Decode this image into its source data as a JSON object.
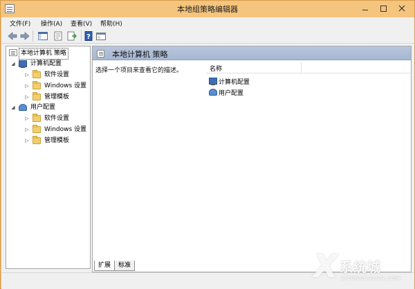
{
  "window": {
    "title": "本地组策略编辑器"
  },
  "menu": {
    "file": "文件(F)",
    "action": "操作(A)",
    "view": "查看(V)",
    "help": "帮助(H)"
  },
  "toolbar": {
    "icons": [
      "back-arrow-icon",
      "forward-arrow-icon",
      "show-tree-icon",
      "properties-icon",
      "export-list-icon",
      "help-icon",
      "console-icon"
    ]
  },
  "tree": {
    "root": "本地计算机 策略",
    "computer_config": {
      "label": "计算机配置",
      "children": [
        "软件设置",
        "Windows 设置",
        "管理模板"
      ]
    },
    "user_config": {
      "label": "用户配置",
      "children": [
        "软件设置",
        "Windows 设置",
        "管理模板"
      ]
    }
  },
  "right_pane": {
    "header_title": "本地计算机 策略",
    "description": "选择一个项目来查看它的描述。",
    "column_name": "名称",
    "items": [
      "计算机配置",
      "用户配置"
    ]
  },
  "tabs": {
    "expanded": "扩展",
    "standard": "标准"
  },
  "watermark": {
    "logo": "X",
    "text_cn": "系统城",
    "text_en": "XITONGCHENG.COM"
  },
  "colors": {
    "titlebar": "#f5c47d",
    "pane_header": "#a6b7d1",
    "folder": "#f2cf6b"
  }
}
